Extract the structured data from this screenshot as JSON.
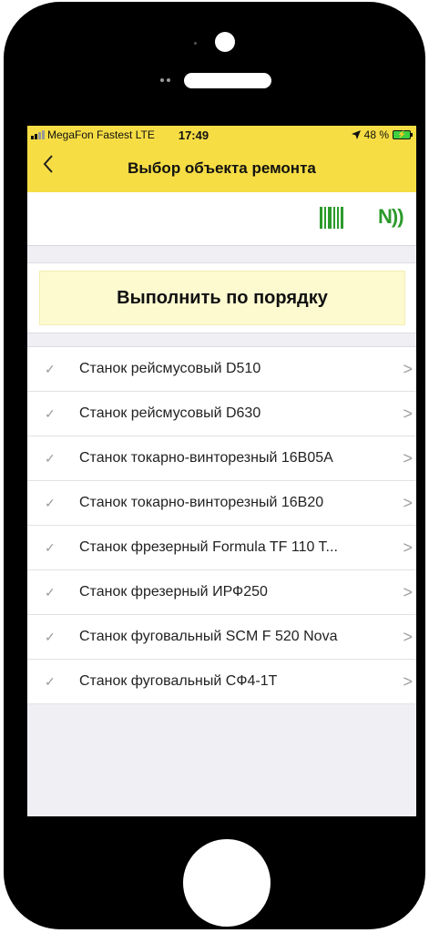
{
  "status_bar": {
    "carrier": "MegaFon Fastest",
    "network": "LTE",
    "time": "17:49",
    "battery": "48 %",
    "location_icon": "location-arrow-icon",
    "battery_icon": "battery-charging-icon"
  },
  "nav": {
    "title": "Выбор объекта ремонта",
    "back_icon": "chevron-left-icon"
  },
  "toolbar": {
    "barcode_icon": "barcode-icon",
    "nfc_icon": "nfc-icon",
    "accent_color": "#2c9a2c"
  },
  "action": {
    "execute_label": "Выполнить по порядку"
  },
  "items": [
    {
      "label": "Станок рейсмусовый D510"
    },
    {
      "label": "Станок рейсмусовый D630"
    },
    {
      "label": "Станок токарно-винторезный 16В05А"
    },
    {
      "label": "Станок токарно-винторезный 16В20"
    },
    {
      "label": "Станок фрезерный Formula TF 110 T..."
    },
    {
      "label": "Станок фрезерный ИРФ250"
    },
    {
      "label": "Станок фуговальный SCM F 520 Nova"
    },
    {
      "label": "Станок фуговальный СФ4-1Т"
    }
  ],
  "colors": {
    "header": "#f6dd44",
    "execute_button": "#fdfad0",
    "background": "#efeff4"
  }
}
